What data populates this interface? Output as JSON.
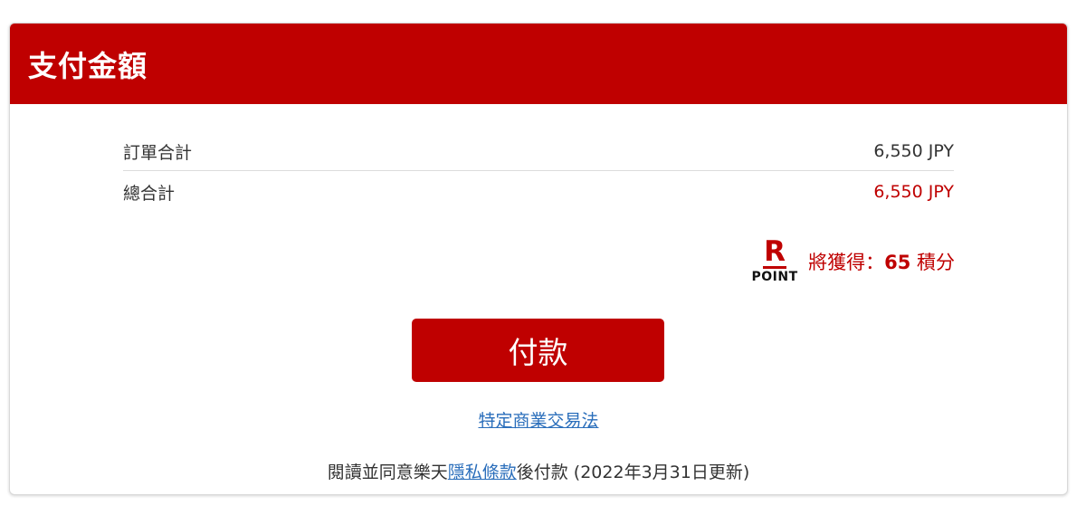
{
  "header": {
    "title": "支付金額"
  },
  "summary": {
    "order_total_label": "訂單合計",
    "order_total_value": "6,550 JPY",
    "grand_total_label": "總合計",
    "grand_total_value": "6,550 JPY"
  },
  "points": {
    "logo_letter": "R",
    "logo_text": "POINT",
    "earn_label": "將獲得：",
    "earn_value": "65",
    "earn_unit": " 積分"
  },
  "actions": {
    "pay_label": "付款"
  },
  "links": {
    "commerce_law": "特定商業交易法",
    "terms_prefix": "閱讀並同意樂天",
    "privacy_link": "隱私條款",
    "terms_suffix": "後付款 (2022年3月31日更新)"
  },
  "colors": {
    "brand_red": "#bf0000",
    "link_blue": "#2a6ebb"
  }
}
